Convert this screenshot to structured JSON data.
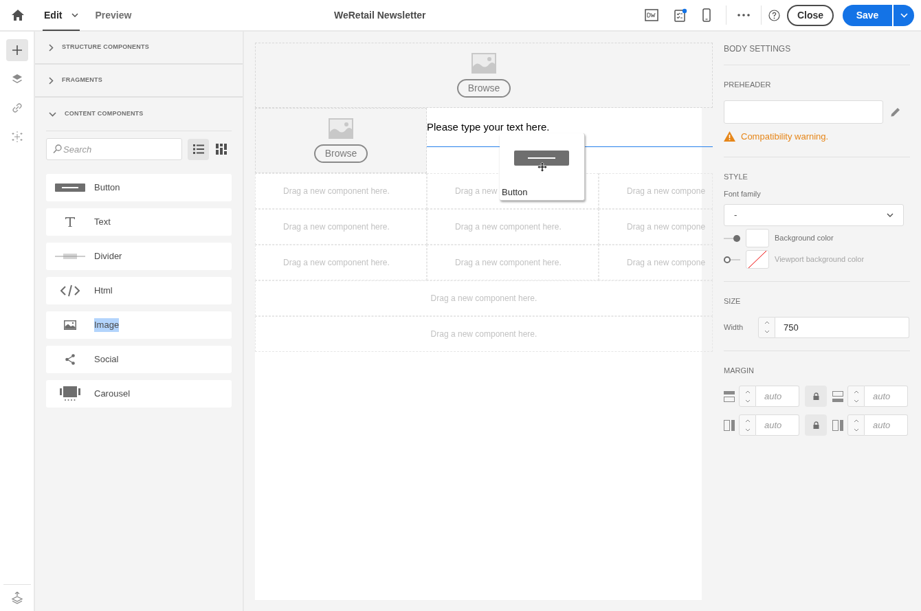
{
  "topbar": {
    "tabs": [
      {
        "label": "Edit",
        "selected": true,
        "has_menu": true
      },
      {
        "label": "Preview",
        "selected": false,
        "has_menu": false
      }
    ],
    "title": "WeRetail Newsletter",
    "close": "Close",
    "save": "Save"
  },
  "rail": [
    {
      "kind": "add",
      "selected": true
    },
    {
      "kind": "layers",
      "selected": false
    },
    {
      "kind": "link",
      "selected": false
    },
    {
      "kind": "personalize",
      "selected": false
    }
  ],
  "panel": {
    "sections": [
      {
        "label": "STRUCTURE COMPONENTS",
        "expanded": false
      },
      {
        "label": "FRAGMENTS",
        "expanded": false
      },
      {
        "label": "CONTENT COMPONENTS",
        "expanded": true
      }
    ],
    "search": {
      "placeholder": "Search"
    },
    "views": [
      {
        "kind": "list",
        "selected": true
      },
      {
        "kind": "grid",
        "selected": false
      }
    ],
    "components": [
      {
        "kind": "button",
        "label": "Button",
        "highlighted": false
      },
      {
        "kind": "text",
        "label": "Text",
        "highlighted": false
      },
      {
        "kind": "divider",
        "label": "Divider",
        "highlighted": false
      },
      {
        "kind": "html",
        "label": "Html",
        "highlighted": false
      },
      {
        "kind": "image",
        "label": "Image",
        "highlighted": true
      },
      {
        "kind": "social",
        "label": "Social",
        "highlighted": false
      },
      {
        "kind": "carousel",
        "label": "Carousel",
        "highlighted": false
      }
    ]
  },
  "canvas": {
    "rows": [
      {
        "cells": [
          {
            "kind": "image",
            "button": "Browse"
          }
        ]
      },
      {
        "cells": [
          {
            "kind": "image",
            "button": "Browse"
          },
          {
            "kind": "text",
            "text": "Please type your text here."
          }
        ]
      },
      {
        "cells": [
          {
            "kind": "drop",
            "text": "Drag a new component here."
          },
          {
            "kind": "drop",
            "text": "Drag a new"
          },
          {
            "kind": "drop",
            "text": "Drag a new compone"
          }
        ]
      },
      {
        "cells": [
          {
            "kind": "drop",
            "text": "Drag a new component here."
          },
          {
            "kind": "drop",
            "text": "Drag a new component here."
          },
          {
            "kind": "drop",
            "text": "Drag a new compone"
          }
        ]
      },
      {
        "cells": [
          {
            "kind": "drop",
            "text": "Drag a new component here."
          },
          {
            "kind": "drop",
            "text": "Drag a new component here."
          },
          {
            "kind": "drop",
            "text": "Drag a new compone"
          }
        ]
      },
      {
        "cells": [
          {
            "kind": "drop",
            "text": "Drag a new component here."
          }
        ]
      },
      {
        "cells": [
          {
            "kind": "drop",
            "text": "Drag a new component here."
          }
        ]
      }
    ],
    "drag_ghost": {
      "label": "Button"
    }
  },
  "settings": {
    "title": "BODY SETTINGS",
    "preheader": {
      "heading": "PREHEADER",
      "warning": "Compatibility warning."
    },
    "style": {
      "heading": "STYLE",
      "font_label": "Font family",
      "font_value": "-",
      "colors": [
        {
          "label": "Background color",
          "on": true
        },
        {
          "label": "Viewport background color",
          "on": false
        }
      ]
    },
    "size": {
      "heading": "SIZE",
      "width_label": "Width",
      "width_value": "750"
    },
    "margin": {
      "heading": "MARGIN",
      "fields": [
        {
          "kind": "top",
          "placeholder": "auto"
        },
        {
          "kind": "bottom",
          "placeholder": "auto"
        },
        {
          "kind": "left",
          "placeholder": "auto"
        },
        {
          "kind": "right",
          "placeholder": "auto"
        }
      ]
    }
  }
}
